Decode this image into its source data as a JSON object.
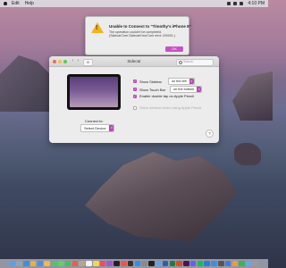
{
  "menubar": {
    "items": [
      "Edit",
      "Help"
    ],
    "clock": "4:10 PM"
  },
  "alert": {
    "title": "Unable to Connect to \"Timothy's iPhone 8\"",
    "message": "The operation couldn't be completed. (SidecarCore.SidecarErrorCore error 200001.)",
    "ok_label": "OK"
  },
  "window": {
    "title": "Sidecar",
    "grid_label": "Ⅲ",
    "search_placeholder": "Search",
    "options": [
      {
        "label": "Show Sidebar",
        "value": "on the left"
      },
      {
        "label": "Show Touch Bar",
        "value": "on the bottom"
      },
      {
        "label": "Enable double tap on Apple Pencil"
      },
      {
        "label": "Show window when using Apple Pencil"
      }
    ],
    "connect_label": "Connect to:",
    "device_select": "Select Device",
    "help": "?"
  },
  "colors": {
    "accent": "#b84ab5",
    "alert_icon": "#f0b420"
  },
  "dock": {
    "apps": [
      "finder",
      "launchpad",
      "safari",
      "chrome",
      "mail",
      "photos",
      "maps",
      "messages",
      "facetime",
      "calendar",
      "contacts",
      "reminders",
      "notes",
      "music",
      "podcasts",
      "tv",
      "news",
      "stocks",
      "app-store",
      "system-preferences",
      "terminal",
      "preview",
      "word",
      "excel",
      "powerpoint",
      "slack",
      "discord",
      "spotify",
      "vscode",
      "xcode",
      "activity-monitor",
      "keynote",
      "pages",
      "numbers",
      "downloads",
      "trash"
    ],
    "colors": [
      "#5aa0e8",
      "#9aa0aa",
      "#3b8fe0",
      "#e9b23c",
      "#4a8fe6",
      "#f2b84b",
      "#5cbf6e",
      "#5bd26a",
      "#45c15a",
      "#f05a4f",
      "#b8a48c",
      "#f2f2f2",
      "#f7d64f",
      "#f04a68",
      "#9b59d0",
      "#222222",
      "#f0534f",
      "#333333",
      "#2f8ef0",
      "#8a8a8a",
      "#222222",
      "#6aa0d8",
      "#2b5fb4",
      "#1f7a43",
      "#cf4f2a",
      "#4a154b",
      "#5865f2",
      "#1db954",
      "#2c7bd4",
      "#3a8ee6",
      "#555555",
      "#3d7be0",
      "#f29a3a",
      "#3bb455",
      "#6aa6e0",
      "#9a9a9a"
    ]
  }
}
